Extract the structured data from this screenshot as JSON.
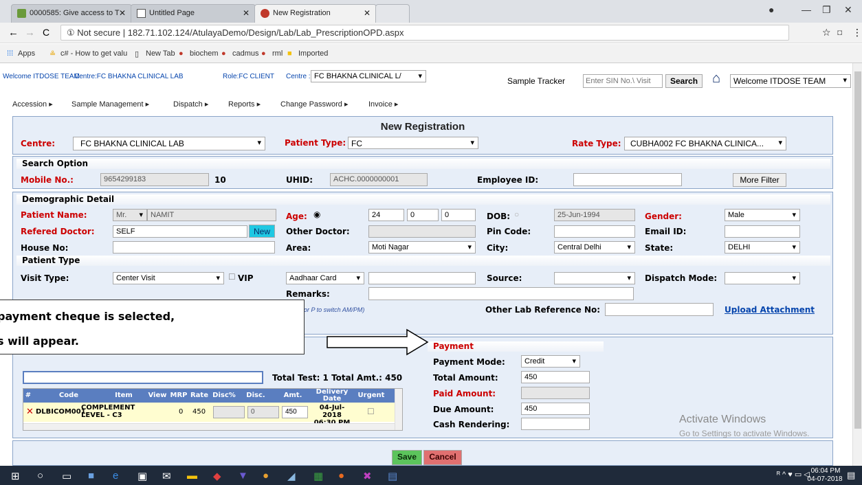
{
  "browser": {
    "tabs": [
      {
        "label": "0000585: Give access to T",
        "active": false
      },
      {
        "label": "Untitled Page",
        "active": false
      },
      {
        "label": "New Registration",
        "active": true
      }
    ],
    "url": "① Not secure  |  182.71.102.124/AtulayaDemo/Design/Lab/Lab_PrescriptionOPD.aspx",
    "bookmarks": [
      "Apps",
      "c# - How to get valu",
      "New Tab",
      "biochem",
      "cadmus",
      "rml",
      "Imported"
    ]
  },
  "header": {
    "welcome": "Welcome ITDOSE TEAM",
    "centre_info": "Centre:FC BHAKNA CLINICAL LAB",
    "role": "Role:FC CLIENT",
    "centre_label": "Centre :",
    "centre_value": "FC BHAKNA CLINICAL L/",
    "sample_tracker_label": "Sample Tracker",
    "sample_tracker_placeholder": "Enter SIN No.\\ Visit",
    "search_btn": "Search",
    "user_select": "Welcome ITDOSE TEAM"
  },
  "menu": [
    "Accession ▸",
    "Sample Management ▸",
    "Dispatch ▸",
    "Reports ▸",
    "Change Password ▸",
    "Invoice ▸"
  ],
  "form": {
    "title": "New Registration",
    "centre_label": "Centre:",
    "centre_value": "FC BHAKNA CLINICAL LAB",
    "patient_type_label": "Patient Type:",
    "patient_type_value": "FC",
    "rate_type_label": "Rate Type:",
    "rate_type_value": "CUBHA002 FC BHAKNA CLINICA...",
    "search_option": {
      "title": "Search Option",
      "mobile_label": "Mobile No.:",
      "mobile_value": "9654299183",
      "mobile_count": "10",
      "uhid_label": "UHID:",
      "uhid_value": "ACHC.0000000001",
      "employee_label": "Employee ID:",
      "employee_value": "",
      "more_filter": "More Filter"
    },
    "demographic": {
      "title": "Demographic Detail",
      "patient_name_label": "Patient Name:",
      "title_value": "Mr.",
      "patient_name_value": "NAMIT",
      "age_label": "Age:",
      "age_years": "24",
      "age_months": "0",
      "age_days": "0",
      "dob_label": "DOB:",
      "dob_value": "25-Jun-1994",
      "gender_label": "Gender:",
      "gender_value": "Male",
      "ref_doc_label": "Refered Doctor:",
      "ref_doc_value": "SELF",
      "new_btn": "New",
      "other_doc_label": "Other Doctor:",
      "pin_label": "Pin Code:",
      "email_label": "Email ID:",
      "house_label": "House No:",
      "area_label": "Area:",
      "area_value": "Moti Nagar",
      "city_label": "City:",
      "city_value": "Central Delhi",
      "state_label": "State:",
      "state_value": "DELHI"
    },
    "patient_type": {
      "title": "Patient Type",
      "visit_label": "Visit Type:",
      "visit_value": "Center Visit",
      "vip_label": "VIP",
      "id_type_value": "Aadhaar Card",
      "source_label": "Source:",
      "dispatch_label": "Dispatch Mode:",
      "remarks_label": "Remarks:",
      "time_hint": "or P to switch AM/PM)",
      "other_lab_label": "Other Lab Reference No:",
      "upload_link": "Upload Attachment"
    },
    "tests": {
      "total_text": "Total Test: 1  Total Amt.: 450",
      "columns": [
        "#",
        "Code",
        "Item",
        "View",
        "MRP",
        "Rate",
        "Disc%",
        "Disc.",
        "Amt.",
        "Delivery Date",
        "Urgent"
      ],
      "rows": [
        {
          "code": "DLBICOM001",
          "item": "COMPLEMENT LEVEL - C3",
          "mrp": "0",
          "rate": "450",
          "disc_pct": "",
          "disc": "0",
          "amt": "450",
          "delivery": "04-Jul-2018 06:30 PM"
        }
      ]
    },
    "payment": {
      "title": "Payment",
      "mode_label": "Payment Mode:",
      "mode_value": "Credit",
      "total_label": "Total Amount:",
      "total_value": "450",
      "paid_label": "Paid Amount:",
      "paid_value": "",
      "due_label": "Due Amount:",
      "due_value": "450",
      "cash_label": "Cash Rendering:",
      "cash_value": ""
    },
    "save_btn": "Save",
    "cancel_btn": "Cancel"
  },
  "callout": {
    "line1": "payment  cheque  is  selected,",
    "line2": "s  will  appear."
  },
  "watermark": {
    "line1": "Activate Windows",
    "line2": "Go to Settings to activate Windows."
  },
  "taskbar": {
    "time": "06:04 PM",
    "date": "04-07-2018"
  },
  "colors": {
    "panel_bg": "#e7eef8",
    "label_red": "#cc0000",
    "grid_header": "#5a7ec0",
    "save_btn": "#4caf50",
    "cancel_btn": "#d9534f"
  }
}
